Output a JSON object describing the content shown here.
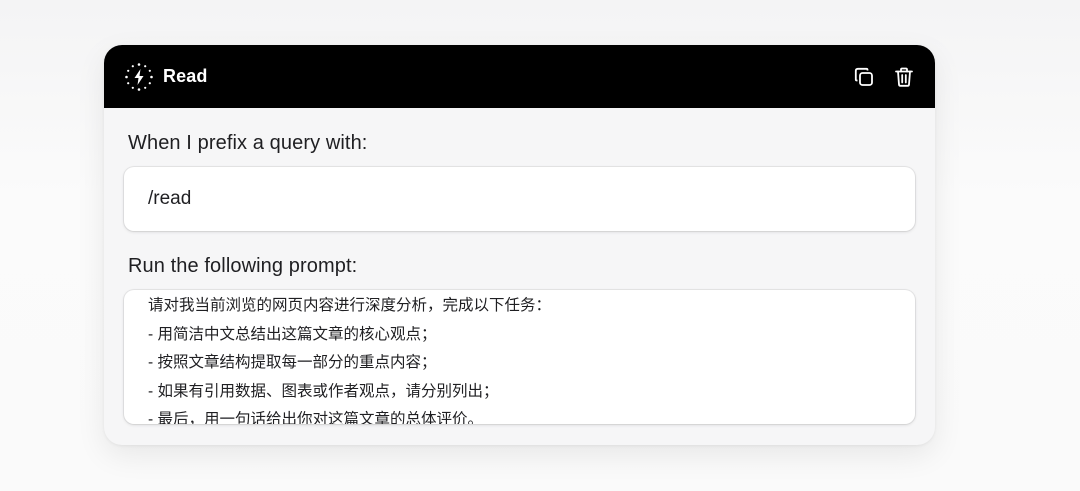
{
  "command": {
    "title": "Read",
    "title_icon": "lightning-sparkle-icon",
    "actions": [
      {
        "name": "copy",
        "icon": "copy-icon"
      },
      {
        "name": "delete",
        "icon": "trash-icon"
      }
    ]
  },
  "prefix_section": {
    "label": "When I prefix a query with:",
    "value": "/read"
  },
  "prompt_section": {
    "label": "Run the following prompt:",
    "lines": [
      "请对我当前浏览的网页内容进行深度分析，完成以下任务：",
      "- 用简洁中文总结出这篇文章的核心观点；",
      "- 按照文章结构提取每一部分的重点内容；",
      "- 如果有引用数据、图表或作者观点，请分别列出；",
      "- 最后，用一句话给出你对这篇文章的总体评价。"
    ]
  },
  "colors": {
    "header_bg": "#000000",
    "card_bg": "#f6f6f7",
    "text": "#1f1f22"
  }
}
